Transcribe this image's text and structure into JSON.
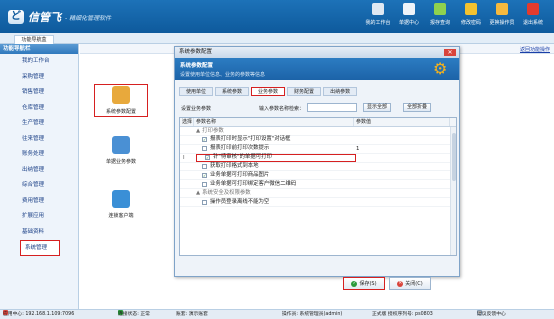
{
  "app": {
    "logo_mark": "ど",
    "name": "信管飞",
    "slogan": "- 精细化管理软件"
  },
  "topnav": [
    {
      "label": "我的工作台",
      "icon": "monitor-icon",
      "color": "#dfe8f2"
    },
    {
      "label": "单据中心",
      "icon": "document-list-icon",
      "color": "#eef3f9"
    },
    {
      "label": "报存查询",
      "icon": "query-doc-icon",
      "color": "#8fd14f"
    },
    {
      "label": "修改密码",
      "icon": "lock-icon",
      "color": "#f2c230"
    },
    {
      "label": "更换操作员",
      "icon": "user-icon",
      "color": "#f5b93e"
    },
    {
      "label": "退出系统",
      "icon": "exit-icon",
      "color": "#e23b2e"
    }
  ],
  "tabstrip": {
    "tab": "功能导航盒"
  },
  "sidebar": {
    "title": "功能导航栏",
    "items": [
      "我的工作台",
      "采购管理",
      "销售管理",
      "仓库管理",
      "生产管理",
      "往来管理",
      "账务处理",
      "出纳管理",
      "综合管理",
      "费用管理",
      "扩展应用",
      "基础资料",
      "系统管理"
    ],
    "active_index": 12
  },
  "main": {
    "help_link": "返回功能操作",
    "tiles": [
      {
        "label": "系统参数配置",
        "icon": "database-config-icon",
        "color": "#e8a93c"
      },
      {
        "label": "单据业务参数",
        "icon": "form-settings-icon",
        "color": "#4a90d4"
      },
      {
        "label": "连锁客户端",
        "icon": "chain-network-icon",
        "color": "#3a8fd6"
      }
    ]
  },
  "dialog": {
    "title": "系统参数配置",
    "close": "✕",
    "banner_title": "系统参数配置",
    "banner_subtitle": "设置使用单位信息、业务的参数等信息",
    "tabs": [
      "使用单位",
      "系统参数",
      "业务参数",
      "财务配置",
      "出纳参数"
    ],
    "selected_tab": 2,
    "search_label": "设置业务参数",
    "keyword_label": "输入参数名称检索：",
    "keyword_value": "",
    "show_all": "显示全部",
    "select_all": "全部折叠",
    "columns": [
      "选择",
      "参数名称",
      "参数值"
    ],
    "rows": [
      {
        "type": "group",
        "marker": "▲",
        "name": "打印参数",
        "value": ""
      },
      {
        "type": "item",
        "checked": true,
        "name": "报表打印时显示\"打印设置\"对话框",
        "value": ""
      },
      {
        "type": "item",
        "checked": false,
        "name": "报表打印前打印次数提示",
        "value": "1"
      },
      {
        "type": "item",
        "checked": true,
        "name": "针\"待审核\"的单据可打印",
        "value": "",
        "selected": true,
        "row_marker": "I"
      },
      {
        "type": "item",
        "checked": false,
        "name": "获取打印格式到本地",
        "value": ""
      },
      {
        "type": "item",
        "checked": true,
        "name": "业务单据可打印商品图片",
        "value": ""
      },
      {
        "type": "item",
        "checked": false,
        "name": "业务单据可打印绑定客户微信二维码",
        "value": ""
      },
      {
        "type": "group",
        "marker": "▲",
        "name": "系统安全及权限参数",
        "value": ""
      },
      {
        "type": "item",
        "checked": false,
        "name": "操作员登录离线不能为空",
        "value": ""
      }
    ],
    "save": "保存(S)",
    "close_btn": "关闭(C)"
  },
  "statusbar": {
    "server": "应用中心: 192.168.1.109:7096",
    "conn_status": "连接状态: 正常",
    "account": "账套: 演示账套",
    "operator": "操作员: 系统管理员(admin)",
    "license": "正式版  授权序列号: ps0803",
    "feedback": "建议反馈中心"
  }
}
